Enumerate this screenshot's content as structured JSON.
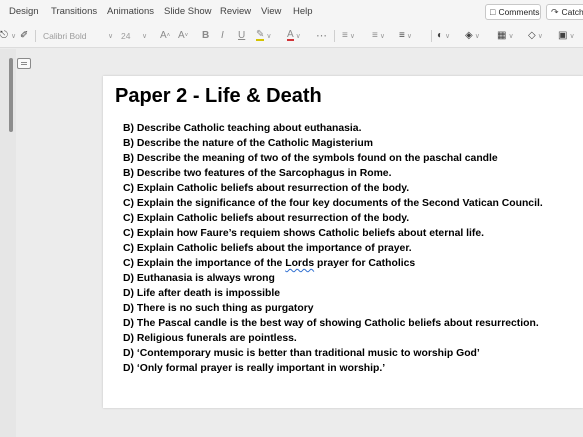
{
  "menu": {
    "items": [
      "Design",
      "Transitions",
      "Animations",
      "Slide Show",
      "Review",
      "View",
      "Help"
    ],
    "comments_label": "Comments",
    "catch_label": "Catch"
  },
  "toolbar": {
    "font_name": "Calibri Bold",
    "font_size": "24"
  },
  "slide": {
    "title": "Paper 2 - Life & Death",
    "questions": [
      "B) Describe Catholic teaching about euthanasia.",
      "B) Describe the nature of the Catholic Magisterium",
      "B) Describe the meaning of two of the symbols found on the paschal candle",
      "B) Describe two features of the Sarcophagus in Rome.",
      "C) Explain Catholic beliefs about resurrection of the body.",
      "C) Explain the significance of the four key documents of the Second Vatican Council.",
      "C) Explain Catholic beliefs about resurrection of the body.",
      "C) Explain how Faure’s requiem shows Catholic beliefs about eternal life.",
      "C) Explain Catholic beliefs about the importance of prayer.",
      "C) Explain the importance of the Lords prayer for Catholics",
      "D) Euthanasia is always wrong",
      "D) Life after death is impossible",
      "D) There is no such thing as purgatory",
      "D) The Pascal candle is the best way of showing Catholic beliefs about resurrection.",
      "D) Religious funerals are pointless.",
      "D) ‘Contemporary music is better than traditional music to worship God’",
      "D) ‘Only formal prayer is really important in worship.’"
    ],
    "q10_parts": [
      "C) Explain the importance of the ",
      "Lords",
      " prayer for Catholics"
    ]
  }
}
